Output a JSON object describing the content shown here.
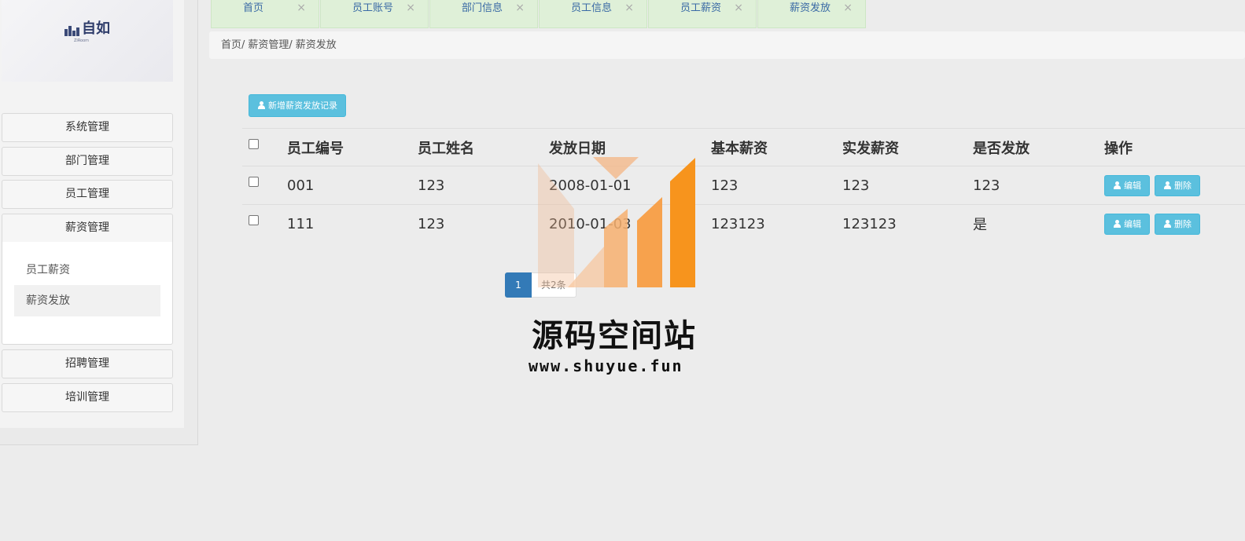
{
  "sidebar": {
    "logo_text": "自如",
    "logo_subtext": "ZiRoom",
    "menu": [
      "系统管理",
      "部门管理",
      "员工管理",
      "薪资管理",
      "招聘管理",
      "培训管理"
    ],
    "submenu": [
      "员工薪资",
      "薪资发放"
    ],
    "active_submenu": "薪资发放"
  },
  "tabs": [
    {
      "label": "首页",
      "close": "×"
    },
    {
      "label": "员工账号",
      "close": "×"
    },
    {
      "label": "部门信息",
      "close": "×"
    },
    {
      "label": "员工信息",
      "close": "×"
    },
    {
      "label": "员工薪资",
      "close": "×"
    },
    {
      "label": "薪资发放",
      "close": "×"
    }
  ],
  "breadcrumb": [
    "首页/",
    "薪资管理/",
    "薪资发放"
  ],
  "toolbar": {
    "add_label": "新增薪资发放记录"
  },
  "table": {
    "columns": [
      "员工编号",
      "员工姓名",
      "发放日期",
      "基本薪资",
      "实发薪资",
      "是否发放",
      "操作"
    ],
    "rows": [
      [
        "001",
        "123",
        "2008-01-01",
        "123",
        "123",
        "123"
      ],
      [
        "111",
        "123",
        "2010-01-03",
        "123123",
        "123123",
        "是"
      ]
    ],
    "edit_label": "编辑",
    "delete_label": "删除"
  },
  "pagination": {
    "current_page": "1",
    "total_text": "共2条"
  },
  "watermark": {
    "title": "源码空间站",
    "url": "www.shuyue.fun"
  },
  "colors": {
    "info_button": "#5bc0de",
    "page_active": "#337ab7",
    "tab_background": "#dff0d8",
    "watermark_light": "#f2b48a",
    "watermark_dark": "#f7941d"
  }
}
